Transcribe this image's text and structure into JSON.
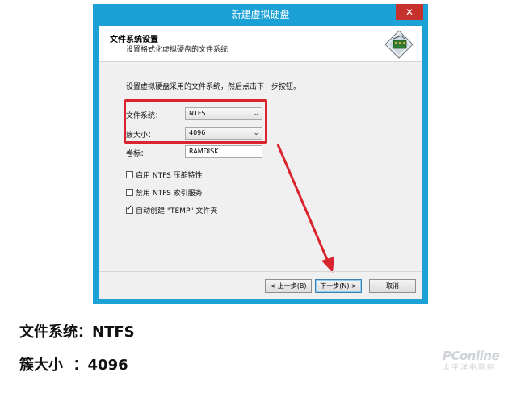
{
  "window": {
    "title": "新建虚拟硬盘",
    "close_glyph": "✕"
  },
  "header": {
    "title": "文件系统设置",
    "subtitle": "设置格式化虚拟硬盘的文件系统",
    "icon": "wizard-icon"
  },
  "form": {
    "instruction": "设置虚拟硬盘采用的文件系统，然后点击下一步按钮。",
    "filesystem_label": "文件系统：",
    "filesystem_value": "NTFS",
    "cluster_label": "簇大小：",
    "cluster_value": "4096",
    "volume_label": "卷标：",
    "volume_value": "RAMDISK",
    "options": [
      {
        "label": "启用 NTFS 压缩特性",
        "checked": false
      },
      {
        "label": "禁用 NTFS 索引服务",
        "checked": false
      },
      {
        "label": "自动创建 \"TEMP\" 文件夹",
        "checked": true
      }
    ]
  },
  "buttons": {
    "back": "< 上一步(B)",
    "next": "下一步(N) >",
    "cancel": "取消"
  },
  "annotation": {
    "highlight_color": "#d9232d"
  },
  "caption": {
    "line1": "文件系统：NTFS",
    "line2": "簇大小  ：4096"
  },
  "watermark": {
    "main": "PConline",
    "sub": "太平洋电脑网"
  }
}
